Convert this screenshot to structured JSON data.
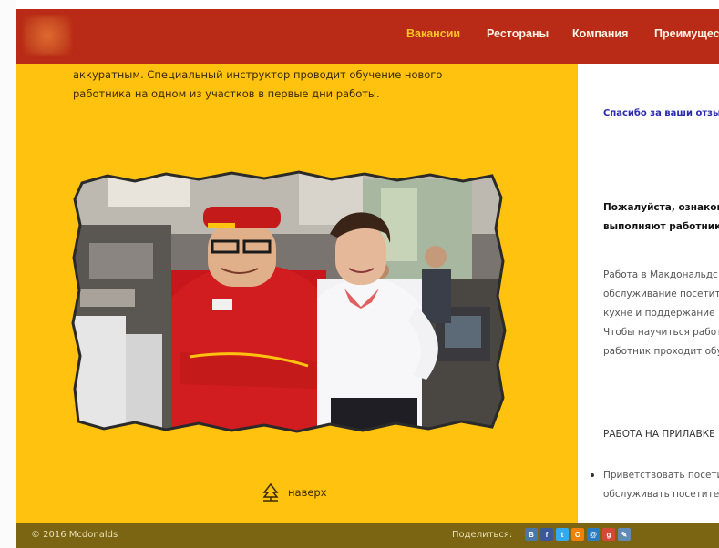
{
  "header": {
    "nav": [
      {
        "label": "Вакансии",
        "active": true
      },
      {
        "label": "Рестораны",
        "active": false
      },
      {
        "label": "Компания",
        "active": false
      },
      {
        "label": "Преимущества",
        "active": false
      }
    ],
    "colors": {
      "bar": "#b92b16",
      "active": "#ffc425"
    }
  },
  "main": {
    "intro_lines": [
      "аккуратным. Специальный инструктор проводит обучение нового",
      "работника на одном из участков в первые дни работы."
    ],
    "back_to_top": "наверх",
    "background": "#ffc20e"
  },
  "sidebar": {
    "thanks": "Спасибо за ваши отзывы",
    "heading_lines": [
      "Пожалуйста, ознакомьтесь",
      "выполняют работники"
    ],
    "para_lines": [
      "Работа в Макдональдс",
      "обслуживание посетителей",
      "кухне и поддержание",
      "Чтобы научиться работе",
      "работник проходит обучение"
    ],
    "section": "РАБОТА НА ПРИЛАВКЕ",
    "list_lines": [
      "Приветствовать посетителей",
      "обслуживать посетителей"
    ]
  },
  "footer": {
    "copyright": "© 2016 Mcdonalds",
    "share_label": "Поделиться:",
    "share_icons": [
      {
        "name": "vk-share-icon",
        "glyph": "В",
        "color": "#4a76a8"
      },
      {
        "name": "facebook-share-icon",
        "glyph": "f",
        "color": "#3b5998"
      },
      {
        "name": "twitter-share-icon",
        "glyph": "t",
        "color": "#33aaee"
      },
      {
        "name": "odnoklassniki-share-icon",
        "glyph": "О",
        "color": "#ee8208"
      },
      {
        "name": "mailru-share-icon",
        "glyph": "@",
        "color": "#2a7bbf"
      },
      {
        "name": "google-share-icon",
        "glyph": "g",
        "color": "#d34836"
      },
      {
        "name": "livejournal-share-icon",
        "glyph": "✎",
        "color": "#5f8bb5"
      }
    ]
  }
}
